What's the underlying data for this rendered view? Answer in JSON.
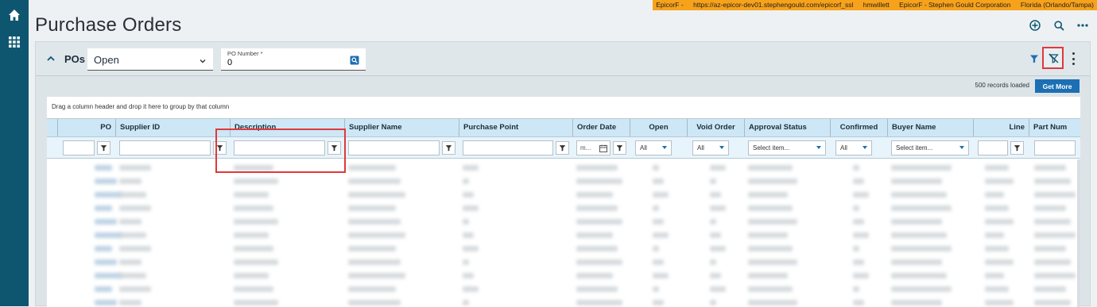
{
  "env_bar": {
    "app": "EpicorF -",
    "url": "https://az-epicor-dev01.stephengould.com/epicorf_ssl",
    "user": "hmwillett",
    "company": "EpicorF - Stephen Gould Corporation",
    "site": "Florida (Orlando/Tampa)"
  },
  "page": {
    "title": "Purchase Orders"
  },
  "panel": {
    "label": "POs",
    "status_select": "Open",
    "po_number_label": "PO Number *",
    "po_number_value": "0",
    "records_loaded": "500 records loaded",
    "get_more_label": "Get More"
  },
  "grid": {
    "group_hint": "Drag a column header and drop it here to group by that column",
    "columns": [
      "PO",
      "Supplier ID",
      "Description",
      "Supplier Name",
      "Purchase Point",
      "Order Date",
      "Open",
      "Void Order",
      "Approval Status",
      "Confirmed",
      "Buyer Name",
      "Line",
      "Part Num"
    ],
    "filters": {
      "date_placeholder": "m...",
      "all_label": "All",
      "select_item": "Select item..."
    }
  },
  "colors": {
    "rail": "#0e5670",
    "env_bar": "#f7a21b",
    "header_bg": "#cde7f7",
    "accent": "#1c6fb3",
    "highlight": "#e0393b"
  },
  "icons": [
    "home-icon",
    "apps-grid-icon",
    "add-circle-icon",
    "search-icon",
    "more-horizontal-icon",
    "chevron-up-icon",
    "chevron-down-icon",
    "search-box-icon",
    "filter-icon",
    "clear-filter-icon",
    "more-vertical-icon",
    "calendar-icon"
  ]
}
